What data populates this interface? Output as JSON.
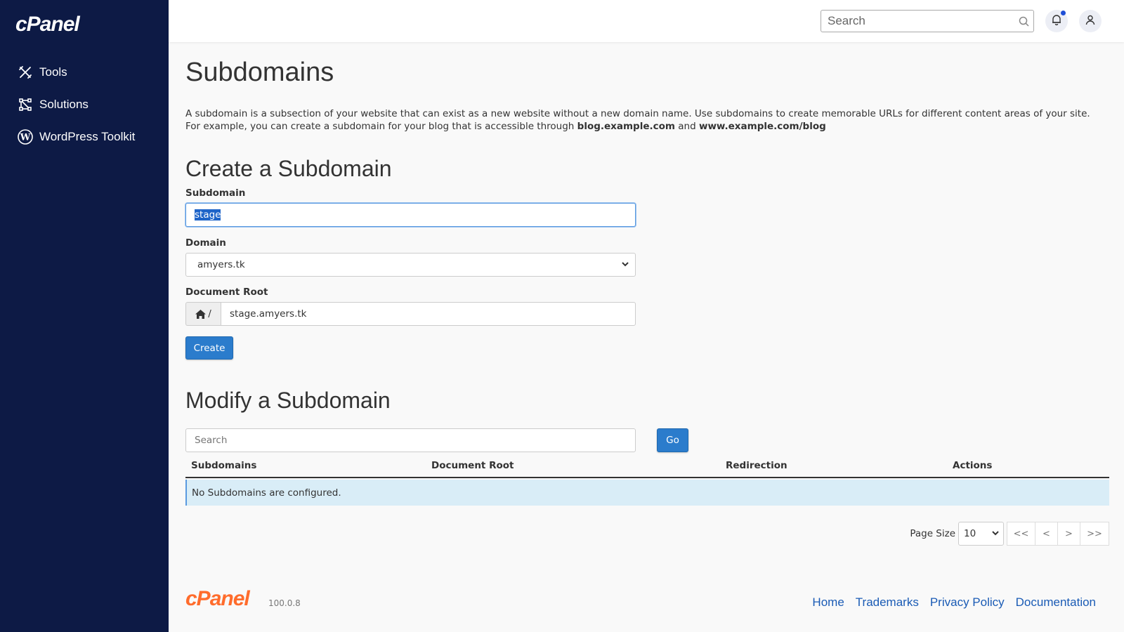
{
  "app": {
    "logo": "cPanel",
    "version": "100.0.8"
  },
  "sidebar": {
    "items": [
      {
        "label": "Tools"
      },
      {
        "label": "Solutions"
      },
      {
        "label": "WordPress Toolkit"
      }
    ]
  },
  "topbar": {
    "search_placeholder": "Search"
  },
  "page": {
    "title": "Subdomains",
    "description_prefix": "A subdomain is a subsection of your website that can exist as a new website without a new domain name. Use subdomains to create memorable URLs for different content areas of your site. For example, you can create a subdomain for your blog that is accessible through ",
    "example1": "blog.example.com",
    "description_and": " and ",
    "example2": "www.example.com/blog"
  },
  "create": {
    "title": "Create a Subdomain",
    "subdomain_label": "Subdomain",
    "subdomain_value": "stage",
    "domain_label": "Domain",
    "domain_value": "amyers.tk",
    "docroot_label": "Document Root",
    "docroot_prefix": "/",
    "docroot_value": "stage.amyers.tk",
    "create_button": "Create"
  },
  "modify": {
    "title": "Modify a Subdomain",
    "search_placeholder": "Search",
    "go_button": "Go",
    "columns": [
      "Subdomains",
      "Document Root",
      "Redirection",
      "Actions"
    ],
    "empty_message": "No Subdomains are configured."
  },
  "pager": {
    "page_size_label": "Page Size",
    "page_size": "10",
    "first": "<<",
    "prev": "<",
    "next": ">",
    "last": ">>"
  },
  "footer": {
    "links": [
      "Home",
      "Trademarks",
      "Privacy Policy",
      "Documentation"
    ]
  }
}
